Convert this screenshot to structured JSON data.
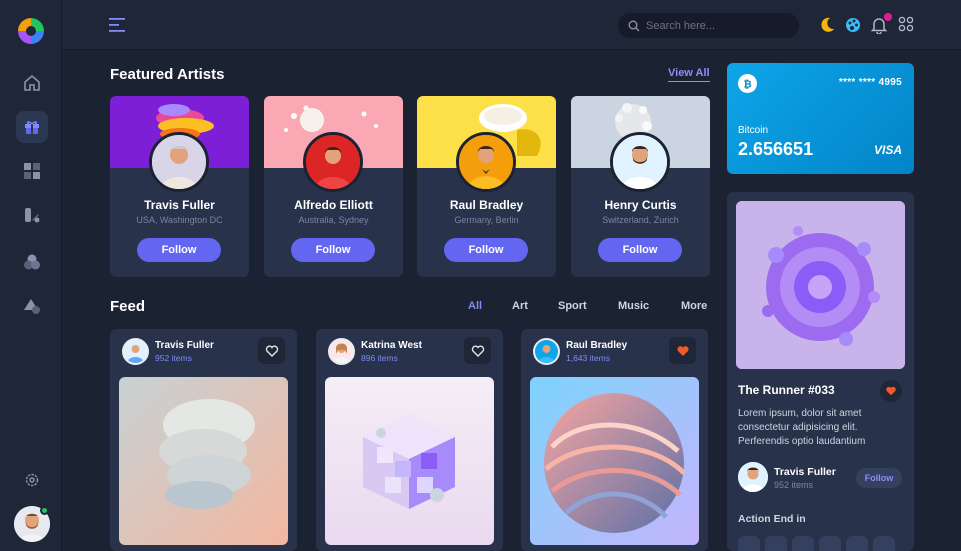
{
  "topbar": {
    "search_placeholder": "Search here..."
  },
  "featured": {
    "title": "Featured Artists",
    "view_all": "View All",
    "artists": [
      {
        "name": "Travis Fuller",
        "location": "USA, Washington DC",
        "follow": "Follow"
      },
      {
        "name": "Alfredo Elliott",
        "location": "Australia, Sydney",
        "follow": "Follow"
      },
      {
        "name": "Raul Bradley",
        "location": "Germany, Berlin",
        "follow": "Follow"
      },
      {
        "name": "Henry Curtis",
        "location": "Switzerland, Zurich",
        "follow": "Follow"
      }
    ]
  },
  "feed": {
    "title": "Feed",
    "tabs": [
      "All",
      "Art",
      "Sport",
      "Music",
      "More"
    ],
    "active_tab": "All",
    "cards": [
      {
        "name": "Travis Fuller",
        "items": "952 items",
        "liked": false
      },
      {
        "name": "Katrina West",
        "items": "896 items",
        "liked": false
      },
      {
        "name": "Raul Bradley",
        "items": "1,643 items",
        "liked": true
      }
    ]
  },
  "wallet": {
    "card_number": "**** **** 4995",
    "coin": "Bitcoin",
    "balance": "2.656651",
    "brand": "VISA"
  },
  "nft": {
    "title": "The Runner #033",
    "description": "Lorem ipsum, dolor sit amet consectetur adipisicing elit. Perferendis optio laudantium",
    "creator_name": "Travis Fuller",
    "creator_items": "952 items",
    "follow": "Follow",
    "auction_label": "Action End in"
  },
  "colors": {
    "accent": "#6366f1",
    "wallet": "#0ea5e9",
    "like": "#f05a28",
    "bg": "#1b2232",
    "card": "#28324a"
  }
}
